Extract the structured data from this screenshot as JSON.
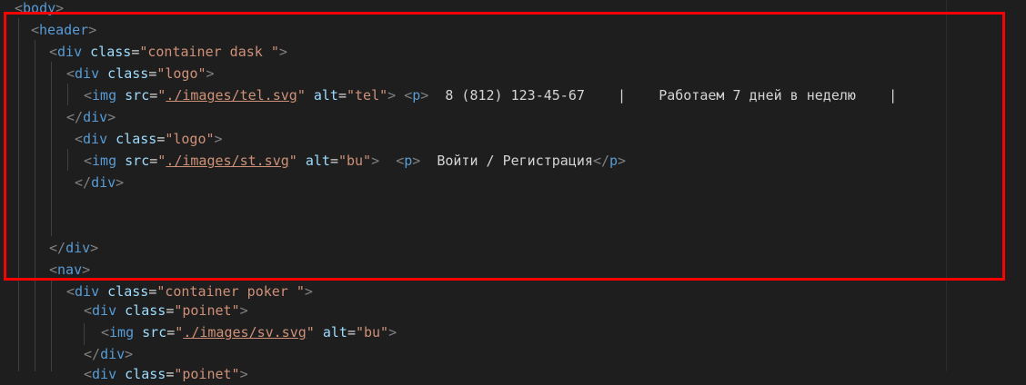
{
  "editor": {
    "colors": {
      "background": "#1e1e1e",
      "tag": "#569cd6",
      "attribute": "#9cdcfe",
      "string": "#ce9178",
      "bracket": "#808080",
      "text": "#d4d4d4",
      "highlight_border": "#ff0000"
    },
    "lines": [
      {
        "segments": [
          "<",
          "body",
          ">"
        ]
      },
      {
        "segments": [
          "<",
          "header",
          ">"
        ]
      },
      {
        "segments": [
          "<",
          "div",
          "class",
          "=",
          "\"container dask \"",
          ">"
        ]
      },
      {
        "segments": [
          "<",
          "div",
          "class",
          "=",
          "\"logo\"",
          ">"
        ]
      },
      {
        "segments": [
          "<",
          "img",
          "src",
          "=",
          "\"",
          "./images/tel.svg",
          "\"",
          "alt",
          "=",
          "\"tel\"",
          ">",
          "<",
          "p",
          ">",
          "8 (812) 123-45-67",
          "|",
          "Работаем 7 дней в неделю",
          "|"
        ]
      },
      {
        "segments": [
          "</",
          "div",
          ">"
        ]
      },
      {
        "segments": [
          "<",
          "div",
          "class",
          "=",
          "\"logo\"",
          ">"
        ]
      },
      {
        "segments": [
          "<",
          "img",
          "src",
          "=",
          "\"",
          "./images/st.svg",
          "\"",
          "alt",
          "=",
          "\"bu\"",
          ">",
          "<",
          "p",
          ">",
          "Войти / Регистрация",
          "</",
          "p",
          ">"
        ]
      },
      {
        "segments": [
          "</",
          "div",
          ">"
        ]
      },
      {
        "segments": []
      },
      {
        "segments": []
      },
      {
        "segments": [
          "</",
          "div",
          ">"
        ]
      },
      {
        "segments": [
          "<",
          "nav",
          ">"
        ]
      },
      {
        "segments": [
          "<",
          "div",
          "class",
          "=",
          "\"container poker \"",
          ">"
        ]
      },
      {
        "segments": [
          "<",
          "div",
          "class",
          "=",
          "\"poinet\"",
          ">"
        ]
      },
      {
        "segments": [
          "<",
          "img",
          "src",
          "=",
          "\"",
          "./images/sv.svg",
          "\"",
          "alt",
          "=",
          "\"bu\"",
          ">"
        ]
      },
      {
        "segments": [
          "</",
          "div",
          ">"
        ]
      },
      {
        "segments": [
          "<",
          "div",
          "class",
          "=",
          "\"poinet\"",
          ">"
        ]
      }
    ]
  }
}
